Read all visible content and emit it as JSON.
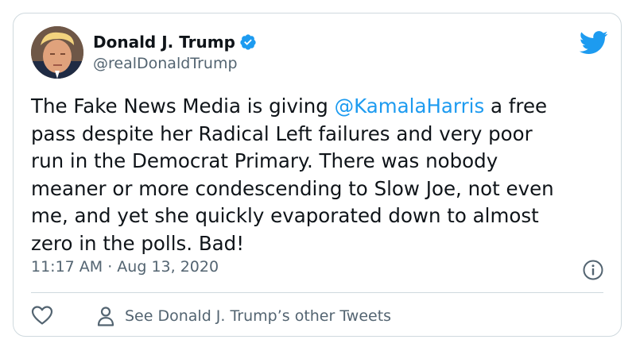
{
  "author": {
    "name": "Donald J. Trump",
    "handle": "@realDonaldTrump",
    "verified": true,
    "avatar_icon": "profile-photo"
  },
  "tweet": {
    "lines": [
      {
        "before": "The Fake News Media is giving ",
        "mention": "@KamalaHarris",
        "after": " a free"
      },
      {
        "text": "pass despite her Radical Left failures and very poor"
      },
      {
        "text": "run in the Democrat Primary. There was nobody"
      },
      {
        "text": "meaner or more condescending to Slow Joe, not even"
      },
      {
        "text": "me, and yet she quickly evaporated down to almost"
      },
      {
        "text": "zero in the polls. Bad!"
      }
    ],
    "timestamp": "11:17 AM · Aug 13, 2020"
  },
  "actions": {
    "like_icon": "heart-icon",
    "other_tweets_icon": "person-icon",
    "other_tweets_label": "See Donald J. Trump’s other Tweets"
  },
  "colors": {
    "accent": "#1d9bf0",
    "text": "#0f1419",
    "secondary": "#536471",
    "border": "#cfd9de"
  }
}
